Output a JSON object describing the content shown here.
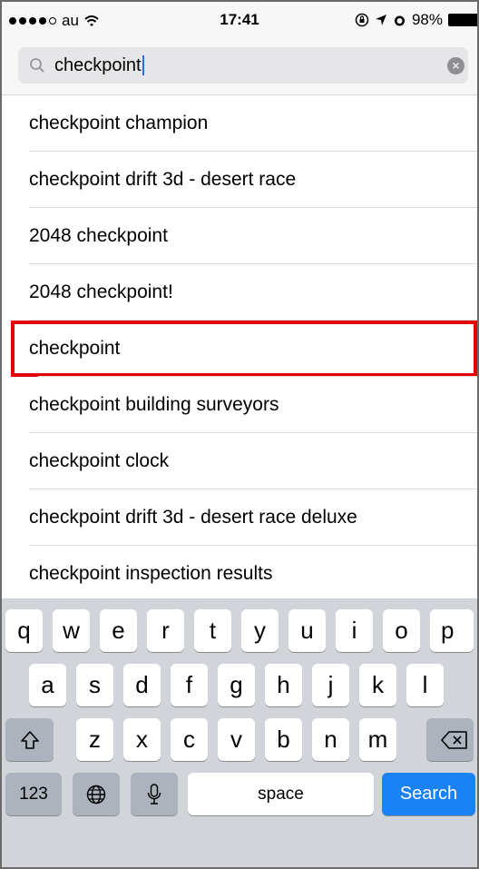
{
  "status": {
    "carrier": "au",
    "time": "17:41",
    "battery": "98%"
  },
  "search": {
    "query": "checkpoint"
  },
  "suggestions": [
    "checkpoint champion",
    "checkpoint drift 3d - desert race",
    "2048 checkpoint",
    "2048 checkpoint!",
    "checkpoint",
    "checkpoint building surveyors",
    "checkpoint clock",
    "checkpoint drift 3d - desert race deluxe",
    "checkpoint inspection results"
  ],
  "keyboard": {
    "row1": [
      "q",
      "w",
      "e",
      "r",
      "t",
      "y",
      "u",
      "i",
      "o",
      "p"
    ],
    "row2": [
      "a",
      "s",
      "d",
      "f",
      "g",
      "h",
      "j",
      "k",
      "l"
    ],
    "row3": [
      "z",
      "x",
      "c",
      "v",
      "b",
      "n",
      "m"
    ],
    "numbers_label": "123",
    "space_label": "space",
    "search_label": "Search"
  },
  "colors": {
    "highlight": "#e50000",
    "search_key": "#1b82f5"
  }
}
